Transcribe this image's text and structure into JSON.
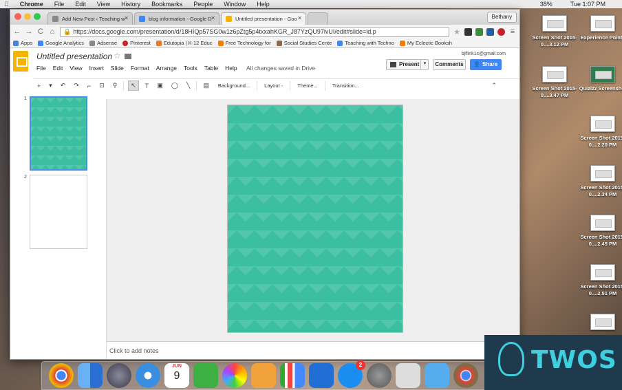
{
  "menubar": {
    "items": [
      "Chrome",
      "File",
      "Edit",
      "View",
      "History",
      "Bookmarks",
      "People",
      "Window",
      "Help"
    ],
    "battery": "38%",
    "clock": "Tue 1:07 PM"
  },
  "desktop": {
    "icons": [
      {
        "label": "Screen Shot 2015-0....3.12 PM"
      },
      {
        "label": "Experience Points"
      },
      {
        "label": "Screen Shot 2015-0....3.47 PM"
      },
      {
        "label": "Quizizz Screenshot"
      },
      {
        "label": "Screen Shot 2015-0....2.20 PM"
      },
      {
        "label": "Screen Shot 2015-0....2.34 PM"
      },
      {
        "label": "Screen Shot 2015-0....2.45 PM"
      },
      {
        "label": "Screen Shot 2015-0....2.51 PM"
      }
    ]
  },
  "browser": {
    "tabs": [
      {
        "title": "Add New Post ‹ Teaching w",
        "active": false
      },
      {
        "title": "blog information - Google D",
        "active": false
      },
      {
        "title": "Untitled presentation - Goo",
        "active": true
      }
    ],
    "user": "Bethany",
    "url": "https://docs.google.com/presentation/d/18HIQp57SG0w1z6pZtg5p4txxahKGR_J87YzQU97lvUI/edit#slide=id.p",
    "bookmarks": [
      "Apps",
      "Google Analytics",
      "Adsense",
      "Pinterest",
      "Edutopia | K-12 Educ",
      "Free Technology for",
      "Social Studies Cente",
      "Teaching with Techno",
      "My Eclectic Booksh"
    ]
  },
  "slides": {
    "doc_title": "Untitled presentation",
    "account": "bjflink1s@gmail.com",
    "menus": [
      "File",
      "Edit",
      "View",
      "Insert",
      "Slide",
      "Format",
      "Arrange",
      "Tools",
      "Table",
      "Help"
    ],
    "save_status": "All changes saved in Drive",
    "present_label": "Present",
    "comments_label": "Comments",
    "share_label": "Share",
    "toolbar": {
      "background": "Background...",
      "layout": "Layout -",
      "theme": "Theme...",
      "transition": "Transition..."
    },
    "slide_numbers": [
      "1",
      "2"
    ],
    "notes_placeholder": "Click to add notes",
    "slide_color": "#3bbfa0"
  },
  "dock": {
    "calendar_month": "JUN",
    "calendar_day": "9",
    "appstore_badge": "2"
  },
  "watermark": {
    "text": "TWOS"
  }
}
